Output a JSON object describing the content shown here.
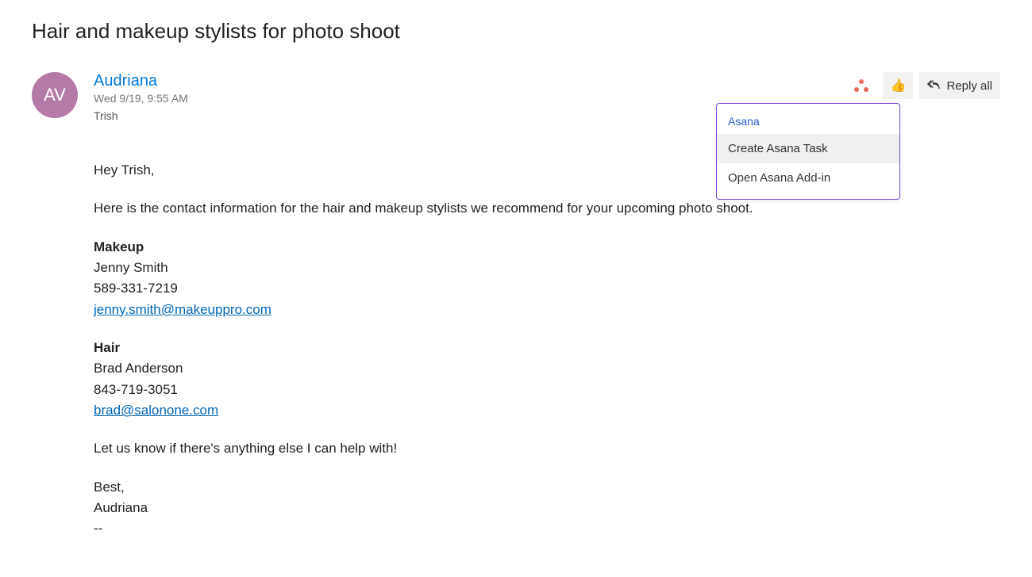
{
  "subject": "Hair and makeup stylists for photo shoot",
  "sender": {
    "initials": "AV",
    "name": "Audriana",
    "timestamp": "Wed 9/19, 9:55 AM",
    "recipient": "Trish"
  },
  "actions": {
    "replyAll": "Reply all"
  },
  "dropdown": {
    "title": "Asana",
    "items": [
      "Create Asana Task",
      "Open Asana Add-in"
    ]
  },
  "body": {
    "greeting": "Hey Trish,",
    "intro": "Here is the contact information for the hair and makeup stylists we recommend for your upcoming photo shoot.",
    "makeup": {
      "heading": "Makeup",
      "name": "Jenny Smith",
      "phone": "589-331-7219",
      "email": "jenny.smith@makeuppro.com"
    },
    "hair": {
      "heading": "Hair",
      "name": "Brad Anderson",
      "phone": "843-719-3051",
      "email": "brad@salonone.com"
    },
    "closing": "Let us know if there's anything else I can help with!",
    "signoff": "Best,",
    "signature": "Audriana",
    "sep": "--"
  }
}
